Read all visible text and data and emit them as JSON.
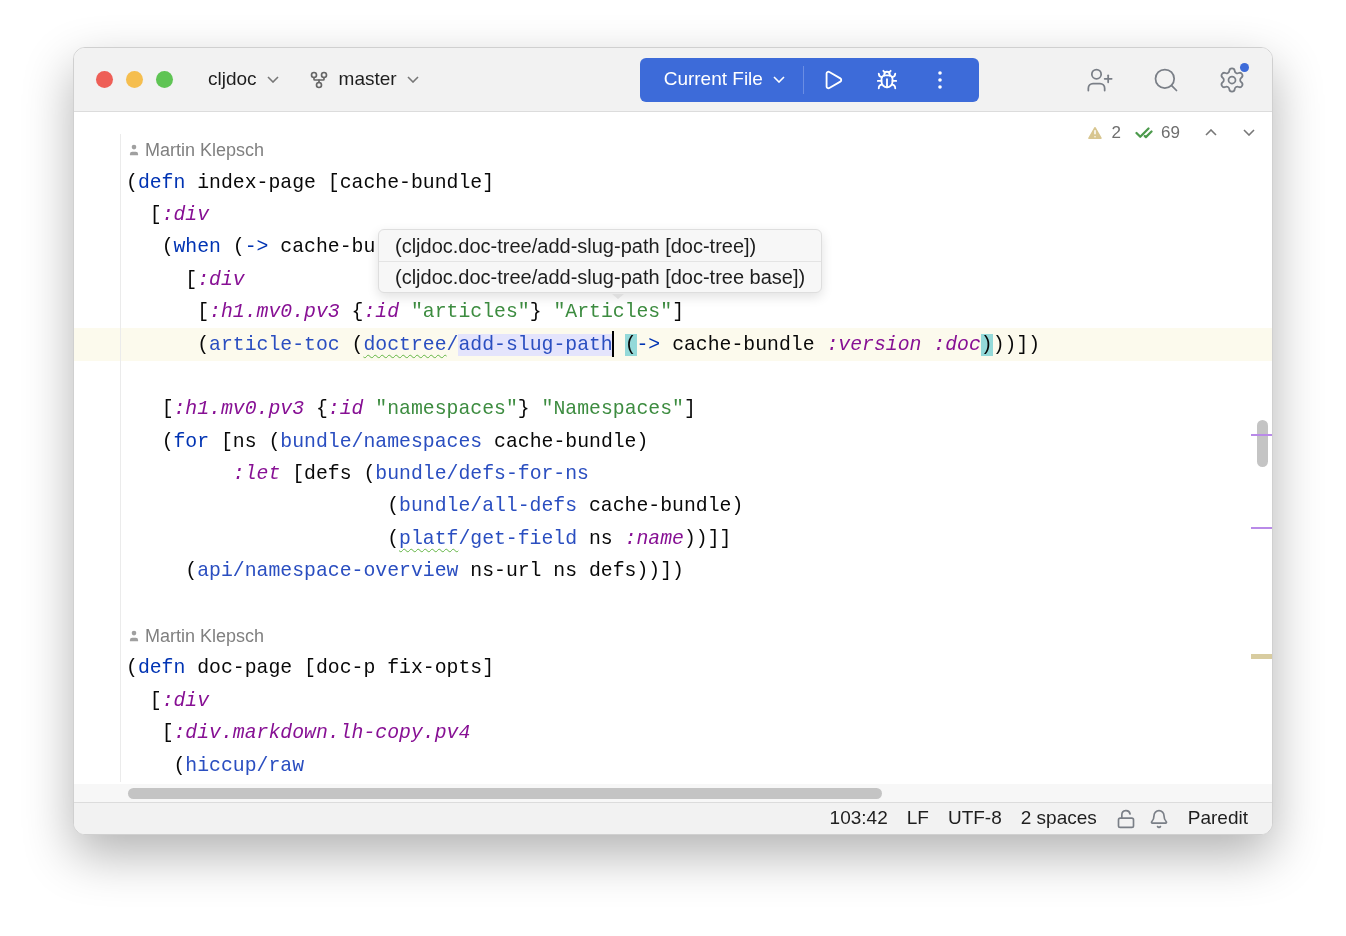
{
  "toolbar": {
    "project": "cljdoc",
    "branch": "master",
    "run_config": "Current File"
  },
  "inspections": {
    "warnings": "2",
    "checks": "69"
  },
  "editor": {
    "lines": [
      {
        "kind": "author",
        "text": "Martin Klepsch"
      },
      {
        "kind": "code",
        "current": false,
        "tokens": [
          {
            "kind": "plain",
            "text": "("
          },
          {
            "kind": "special",
            "text": "defn"
          },
          {
            "kind": "plain",
            "text": " index-page [cache-bundle]"
          }
        ]
      },
      {
        "kind": "code",
        "current": false,
        "tokens": [
          {
            "kind": "plain",
            "text": "  ["
          },
          {
            "kind": "keyword",
            "text": ":div"
          }
        ]
      },
      {
        "kind": "code",
        "current": false,
        "tokens": [
          {
            "kind": "plain",
            "text": "   ("
          },
          {
            "kind": "special",
            "text": "when"
          },
          {
            "kind": "plain",
            "text": " ("
          },
          {
            "kind": "special",
            "text": "->"
          },
          {
            "kind": "plain",
            "text": " cache-bu"
          }
        ]
      },
      {
        "kind": "code",
        "current": false,
        "tokens": [
          {
            "kind": "plain",
            "text": "     ["
          },
          {
            "kind": "keyword",
            "text": ":div"
          }
        ]
      },
      {
        "kind": "code",
        "current": false,
        "tokens": [
          {
            "kind": "plain",
            "text": "      ["
          },
          {
            "kind": "keyword",
            "text": ":h1.mv0.pv3"
          },
          {
            "kind": "plain",
            "text": " {"
          },
          {
            "kind": "keyword",
            "text": ":id"
          },
          {
            "kind": "string",
            "text": " \"articles\""
          },
          {
            "kind": "plain",
            "text": "} "
          },
          {
            "kind": "string",
            "text": "\"Articles\""
          },
          {
            "kind": "plain",
            "text": "]"
          }
        ]
      },
      {
        "kind": "code",
        "current": true,
        "tokens": [
          {
            "kind": "plain",
            "text": "      ("
          },
          {
            "kind": "symbol",
            "text": "article-toc"
          },
          {
            "kind": "plain",
            "text": " ("
          },
          {
            "kind": "symbol",
            "text": "doctree",
            "warning": true
          },
          {
            "kind": "symbol",
            "text": "/"
          },
          {
            "kind": "symbol",
            "text": "add-slug-path ",
            "selection": true,
            "caret": true
          },
          {
            "kind": "plain",
            "text": "(",
            "bracket_match": true
          },
          {
            "kind": "special",
            "text": "->"
          },
          {
            "kind": "plain",
            "text": " cache-bundle "
          },
          {
            "kind": "keyword",
            "text": ":version"
          },
          {
            "kind": "keyword",
            "text": " :doc"
          },
          {
            "kind": "plain",
            "text": ")",
            "bracket_match": true
          },
          {
            "kind": "plain",
            "text": "))])"
          }
        ]
      },
      {
        "kind": "code"
      },
      {
        "kind": "code",
        "current": false,
        "tokens": [
          {
            "kind": "plain",
            "text": "   ["
          },
          {
            "kind": "keyword",
            "text": ":h1.mv0.pv3"
          },
          {
            "kind": "plain",
            "text": " {"
          },
          {
            "kind": "keyword",
            "text": ":id"
          },
          {
            "kind": "string",
            "text": " \"namespaces\""
          },
          {
            "kind": "plain",
            "text": "} "
          },
          {
            "kind": "string",
            "text": "\"Namespaces\""
          },
          {
            "kind": "plain",
            "text": "]"
          }
        ]
      },
      {
        "kind": "code",
        "current": false,
        "tokens": [
          {
            "kind": "plain",
            "text": "   ("
          },
          {
            "kind": "special",
            "text": "for"
          },
          {
            "kind": "plain",
            "text": " [ns ("
          },
          {
            "kind": "symbol",
            "text": "bundle/namespaces"
          },
          {
            "kind": "plain",
            "text": " cache-bundle)"
          }
        ]
      },
      {
        "kind": "code",
        "current": false,
        "tokens": [
          {
            "kind": "keyword",
            "text": "         :let"
          },
          {
            "kind": "plain",
            "text": " [defs ("
          },
          {
            "kind": "symbol",
            "text": "bundle/defs-for-ns"
          }
        ]
      },
      {
        "kind": "code",
        "current": false,
        "tokens": [
          {
            "kind": "plain",
            "text": "                      ("
          },
          {
            "kind": "symbol",
            "text": "bundle/all-defs"
          },
          {
            "kind": "plain",
            "text": " cache-bundle)"
          }
        ]
      },
      {
        "kind": "code",
        "current": false,
        "tokens": [
          {
            "kind": "plain",
            "text": "                      ("
          },
          {
            "kind": "symbol",
            "text": "platf",
            "warning": true
          },
          {
            "kind": "symbol",
            "text": "/get-field"
          },
          {
            "kind": "plain",
            "text": " ns "
          },
          {
            "kind": "keyword",
            "text": ":name"
          },
          {
            "kind": "plain",
            "text": "))]]"
          }
        ]
      },
      {
        "kind": "code",
        "current": false,
        "tokens": [
          {
            "kind": "plain",
            "text": "     ("
          },
          {
            "kind": "symbol",
            "text": "api/namespace-overview"
          },
          {
            "kind": "plain",
            "text": " ns-url ns defs))])"
          }
        ]
      },
      {
        "kind": "code"
      },
      {
        "kind": "author",
        "text": "Martin Klepsch"
      },
      {
        "kind": "code",
        "current": false,
        "tokens": [
          {
            "kind": "plain",
            "text": "("
          },
          {
            "kind": "special",
            "text": "defn"
          },
          {
            "kind": "plain",
            "text": " doc-page [doc-p fix-opts]"
          }
        ]
      },
      {
        "kind": "code",
        "current": false,
        "tokens": [
          {
            "kind": "plain",
            "text": "  ["
          },
          {
            "kind": "keyword",
            "text": ":div"
          }
        ]
      },
      {
        "kind": "code",
        "current": false,
        "tokens": [
          {
            "kind": "plain",
            "text": "   ["
          },
          {
            "kind": "keyword",
            "text": ":div.markdown.lh-copy.pv4"
          }
        ]
      },
      {
        "kind": "code",
        "current": false,
        "tokens": [
          {
            "kind": "plain",
            "text": "    ("
          },
          {
            "kind": "symbol",
            "text": "hiccup/raw"
          }
        ]
      }
    ]
  },
  "popup": {
    "items": [
      {
        "text": "(cljdoc.doc-tree/add-slug-path [doc-tree])",
        "selected": false
      },
      {
        "text": "(cljdoc.doc-tree/add-slug-path [doc-tree base])",
        "selected": false
      }
    ]
  },
  "status_bar": {
    "items": [
      "103:42",
      "LF",
      "UTF-8",
      "2 spaces"
    ],
    "mode": "Paredit"
  }
}
